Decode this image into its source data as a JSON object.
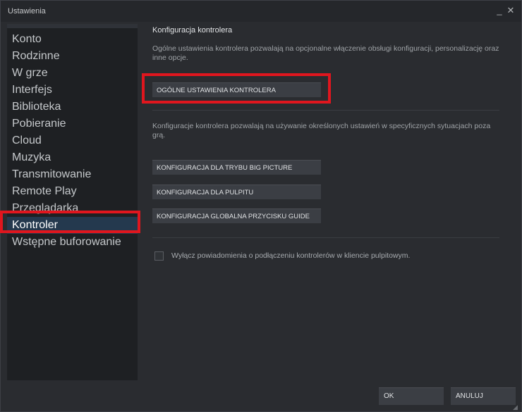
{
  "window": {
    "title": "Ustawienia",
    "minimize_glyph": "_",
    "close_glyph": "✕"
  },
  "sidebar": {
    "items": [
      {
        "label": "Konto"
      },
      {
        "label": "Rodzinne"
      },
      {
        "label": "W grze"
      },
      {
        "label": "Interfejs"
      },
      {
        "label": "Biblioteka"
      },
      {
        "label": "Pobieranie"
      },
      {
        "label": "Cloud"
      },
      {
        "label": "Muzyka"
      },
      {
        "label": "Transmitowanie"
      },
      {
        "label": "Remote Play"
      },
      {
        "label": "Przeglądarka"
      },
      {
        "label": "Kontroler"
      },
      {
        "label": "Wstępne buforowanie"
      }
    ],
    "active_index": 11
  },
  "content": {
    "section_title": "Konfiguracja kontrolera",
    "general_desc": "Ogólne ustawienia kontrolera pozwalają na opcjonalne włączenie obsługi konfiguracji, personalizację oraz inne opcje.",
    "general_button": "OGÓLNE USTAWIENIA KONTROLERA",
    "config_desc": "Konfiguracje kontrolera pozwalają na używanie określonych ustawień w specyficznych sytuacjach poza grą.",
    "config_buttons": [
      {
        "label": "KONFIGURACJA DLA TRYBU BIG PICTURE"
      },
      {
        "label": "KONFIGURACJA DLA PULPITU"
      },
      {
        "label": "KONFIGURACJA GLOBALNA PRZYCISKU GUIDE"
      }
    ],
    "notify_checkbox_label": "Wyłącz powiadomienia o podłączeniu kontrolerów w kliencie pulpitowym.",
    "notify_checkbox_checked": false
  },
  "footer": {
    "ok_label": "OK",
    "cancel_label": "ANULUJ"
  },
  "colors": {
    "highlight": "#e0161e",
    "active_item_bg": "#24394e",
    "button_bg": "#3b3e44"
  }
}
